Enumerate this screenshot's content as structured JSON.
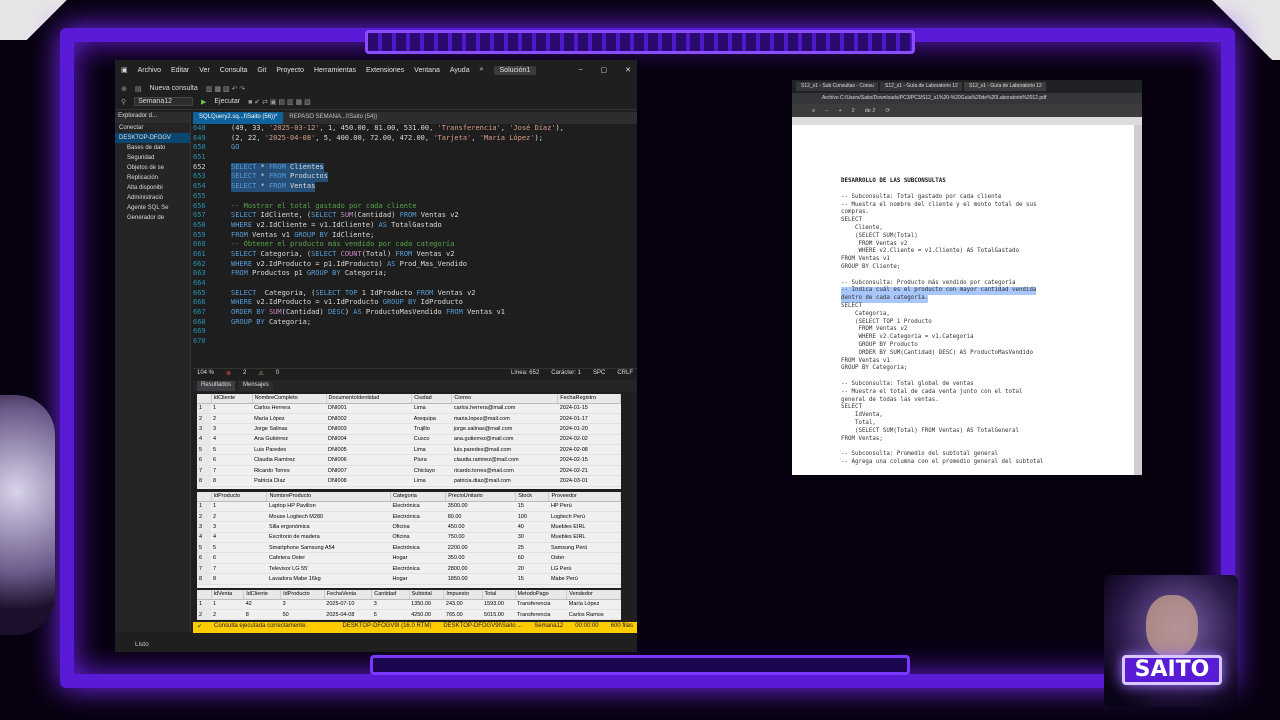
{
  "ssms": {
    "menu": [
      "Archivo",
      "Editar",
      "Ver",
      "Consulta",
      "Git",
      "Proyecto",
      "Herramientas",
      "Extensiones",
      "Ventana",
      "Ayuda"
    ],
    "solution_badge": "Solución1",
    "toolbar_new_query": "Nueva consulta",
    "toolbar_database": "Semana12",
    "toolbar_execute": "Ejecutar",
    "object_explorer": {
      "title": "Explorador d...",
      "connect": "Conectar",
      "server": "DESKTOP-DFOGV",
      "nodes": [
        "Bases de dato",
        "Seguridad",
        "Objetos de se",
        "Replicación",
        "Alta disponibi",
        "Administració",
        "Agente SQL Se",
        "Generador de"
      ]
    },
    "tabs": [
      "SQLQuery2.sq...I\\Saito (56))*",
      "REPASO SEMANA...I\\Saito (54))"
    ],
    "code_lines": [
      {
        "n": "648",
        "t": "(49, 33, '2025-03-12', 1, 450.00, 81.00, 531.00, 'Transferencia', 'José Díaz'),"
      },
      {
        "n": "649",
        "t": "(2, 22, '2025-04-08', 5, 400.00, 72.00, 472.00, 'Tarjeta', 'María López');"
      },
      {
        "n": "650",
        "t": "GO"
      },
      {
        "n": "651",
        "t": ""
      },
      {
        "n": "652",
        "t": "SELECT * FROM Clientes",
        "sel": true,
        "cur": true
      },
      {
        "n": "653",
        "t": "SELECT * FROM Productos",
        "sel": true
      },
      {
        "n": "654",
        "t": "SELECT * FROM Ventas",
        "sel": true
      },
      {
        "n": "655",
        "t": ""
      },
      {
        "n": "656",
        "t": "-- Mostrar el total gastado por cada cliente"
      },
      {
        "n": "657",
        "t": "SELECT IdCliente, (SELECT SUM(Cantidad) FROM Ventas v2"
      },
      {
        "n": "658",
        "t": "WHERE v2.IdCliente = v1.IdCliente) AS TotalGastado"
      },
      {
        "n": "659",
        "t": "FROM Ventas v1 GROUP BY IdCliente;"
      },
      {
        "n": "660",
        "t": "-- Obtener el producto más vendido por cada categoría"
      },
      {
        "n": "661",
        "t": "SELECT Categoria, (SELECT COUNT(Total) FROM Ventas v2"
      },
      {
        "n": "662",
        "t": "WHERE v2.IdProducto = p1.IdProducto) AS Prod_Mas_Vendido"
      },
      {
        "n": "663",
        "t": "FROM Productos p1 GROUP BY Categoria;"
      },
      {
        "n": "664",
        "t": ""
      },
      {
        "n": "665",
        "t": "SELECT  Categoria, (SELECT TOP 1 IdProducto FROM Ventas v2"
      },
      {
        "n": "666",
        "t": "WHERE v2.IdProducto = v1.IdProducto GROUP BY IdProducto"
      },
      {
        "n": "667",
        "t": "ORDER BY SUM(Cantidad) DESC) AS ProductoMasVendido FROM Ventas v1"
      },
      {
        "n": "668",
        "t": "GROUP BY Categoria;"
      },
      {
        "n": "669",
        "t": ""
      },
      {
        "n": "670",
        "t": ""
      }
    ],
    "editor_status": {
      "zoom": "104 %",
      "errors": "2",
      "warnings": "0",
      "line": "Línea: 652",
      "char": "Carácter: 1",
      "spc": "SPC",
      "crlf": "CRLF"
    },
    "results_tabs": [
      "Resultados",
      "Mensajes"
    ],
    "clientes": {
      "columns": [
        "IdCliente",
        "NombreCompleto",
        "DocumentoIdentidad",
        "Ciudad",
        "Correo",
        "FechaRegistro"
      ],
      "rows": [
        [
          "1",
          "1",
          "Carlos Herrera",
          "DNI001",
          "Lima",
          "carlos.herrera@mail.com",
          "2024-01-15"
        ],
        [
          "2",
          "2",
          "María López",
          "DNI002",
          "Arequipa",
          "maria.lopez@mail.com",
          "2024-01-17"
        ],
        [
          "3",
          "3",
          "Jorge Salinas",
          "DNI003",
          "Trujillo",
          "jorge.salinas@mail.com",
          "2024-01-20"
        ],
        [
          "4",
          "4",
          "Ana Gutiérrez",
          "DNI004",
          "Cusco",
          "ana.gutierrez@mail.com",
          "2024-02-02"
        ],
        [
          "5",
          "5",
          "Luis Paredes",
          "DNI005",
          "Lima",
          "luis.paredes@mail.com",
          "2024-02-08"
        ],
        [
          "6",
          "6",
          "Claudia Ramírez",
          "DNI006",
          "Piura",
          "claudia.ramirez@mail.com",
          "2024-02-15"
        ],
        [
          "7",
          "7",
          "Ricardo Torres",
          "DNI007",
          "Chiclayo",
          "ricardo.torres@mail.com",
          "2024-02-21"
        ],
        [
          "8",
          "8",
          "Patricia Díaz",
          "DNI008",
          "Lima",
          "patricia.diaz@mail.com",
          "2024-03-01"
        ]
      ]
    },
    "productos": {
      "columns": [
        "IdProducto",
        "NombreProducto",
        "Categoria",
        "PrecioUnitario",
        "Stock",
        "Proveedor"
      ],
      "rows": [
        [
          "1",
          "1",
          "Laptop HP Pavilion",
          "Electrónica",
          "3500.00",
          "15",
          "HP Perú"
        ],
        [
          "2",
          "2",
          "Mouse Logitech M280",
          "Electrónica",
          "80.00",
          "100",
          "Logitech Perú"
        ],
        [
          "3",
          "3",
          "Silla ergonómica",
          "Oficina",
          "450.00",
          "40",
          "Muebles EIRL"
        ],
        [
          "4",
          "4",
          "Escritorio de madera",
          "Oficina",
          "750.00",
          "30",
          "Muebles EIRL"
        ],
        [
          "5",
          "5",
          "Smartphone Samsung A54",
          "Electrónica",
          "2200.00",
          "25",
          "Samsung Perú"
        ],
        [
          "6",
          "6",
          "Cafetera Oster",
          "Hogar",
          "350.00",
          "60",
          "Oster"
        ],
        [
          "7",
          "7",
          "Televisor LG 55'",
          "Electrónica",
          "2800.00",
          "20",
          "LG Perú"
        ],
        [
          "8",
          "8",
          "Lavadora Mabe 16kg",
          "Hogar",
          "1850.00",
          "15",
          "Mabe Perú"
        ]
      ]
    },
    "ventas": {
      "columns": [
        "IdVenta",
        "IdCliente",
        "IdProducto",
        "FechaVenta",
        "Cantidad",
        "Subtotal",
        "Impuesto",
        "Total",
        "MetodoPago",
        "Vendedor"
      ],
      "rows": [
        [
          "1",
          "1",
          "42",
          "3",
          "2025-07-10",
          "3",
          "1350.00",
          "243.00",
          "1593.00",
          "Transferencia",
          "María López"
        ],
        [
          "2",
          "2",
          "8",
          "50",
          "2025-04-08",
          "5",
          "4250.00",
          "765.00",
          "5015.00",
          "Transferencia",
          "Carlos Ramos"
        ]
      ]
    },
    "exec_status": {
      "message": "Consulta ejecutada correctamente.",
      "server": "DESKTOP-DFOGV9I (16.0 RTM)",
      "user": "DESKTOP-DFOGV9I\\Saito ...",
      "db": "Semana12",
      "time": "00:00:00",
      "rows": "600 filas"
    },
    "app_status": "Listo"
  },
  "pdf": {
    "tabs": [
      "S12_s1 - Sub Consultas - Consu",
      "S12_s1 - Guía de Laboratorio 12",
      "S12_s1 - Guía de Laboratorio 12"
    ],
    "address": "Archivo  C:/Users/Saito/Downloads/PC3/PC3/S12_s1%20-%20Guía%20de%20Laboratorio%2012.pdf",
    "page_indicator": "2",
    "page_total": "de 2",
    "lines": [
      {
        "t": "DESARROLLO DE LAS SUBCONSULTAS",
        "k": "heading"
      },
      {
        "t": "-- Subconsulta: Total gastado por cada cliente"
      },
      {
        "t": "-- Muestra el nombre del cliente y el monto total de sus"
      },
      {
        "t": "compras."
      },
      {
        "t": "SELECT"
      },
      {
        "t": "    Cliente,"
      },
      {
        "t": "    (SELECT SUM(Total)"
      },
      {
        "t": "     FROM Ventas v2"
      },
      {
        "t": "     WHERE v2.Cliente = v1.Cliente) AS TotalGastado"
      },
      {
        "t": "FROM Ventas v1"
      },
      {
        "t": "GROUP BY Cliente;"
      },
      {
        "t": ""
      },
      {
        "t": "-- Subconsulta: Producto más vendido por categoría"
      },
      {
        "t": "-- Indica cuál es el producto con mayor cantidad vendida",
        "k": "hl"
      },
      {
        "t": "dentro de cada categoría.",
        "k": "hl"
      },
      {
        "t": "SELECT"
      },
      {
        "t": "    Categoria,"
      },
      {
        "t": "    (SELECT TOP 1 Producto"
      },
      {
        "t": "     FROM Ventas v2"
      },
      {
        "t": "     WHERE v2.Categoria = v1.Categoria"
      },
      {
        "t": "     GROUP BY Producto"
      },
      {
        "t": "     ORDER BY SUM(Cantidad) DESC) AS ProductoMasVendido"
      },
      {
        "t": "FROM Ventas v1"
      },
      {
        "t": "GROUP BY Categoria;"
      },
      {
        "t": ""
      },
      {
        "t": "-- Subconsulta: Total global de ventas"
      },
      {
        "t": "-- Muestra el total de cada venta junto con el total"
      },
      {
        "t": "general de todas las ventas."
      },
      {
        "t": "SELECT"
      },
      {
        "t": "    IdVenta,"
      },
      {
        "t": "    Total,"
      },
      {
        "t": "    (SELECT SUM(Total) FROM Ventas) AS TotalGeneral"
      },
      {
        "t": "FROM Ventas;"
      },
      {
        "t": ""
      },
      {
        "t": "-- Subconsulta: Promedio del subtotal general"
      },
      {
        "t": "-- Agrega una columna con el promedio general del subtotal"
      }
    ]
  },
  "webcam": {
    "logo": "SAITO"
  },
  "colors": {
    "frame": "#5a1bd6",
    "accent": "#7a2cff",
    "selection": "#264f78",
    "keyword": "#569cd6",
    "string": "#d69d85",
    "comment": "#57a64a",
    "status_bar": "#ffcc00"
  }
}
